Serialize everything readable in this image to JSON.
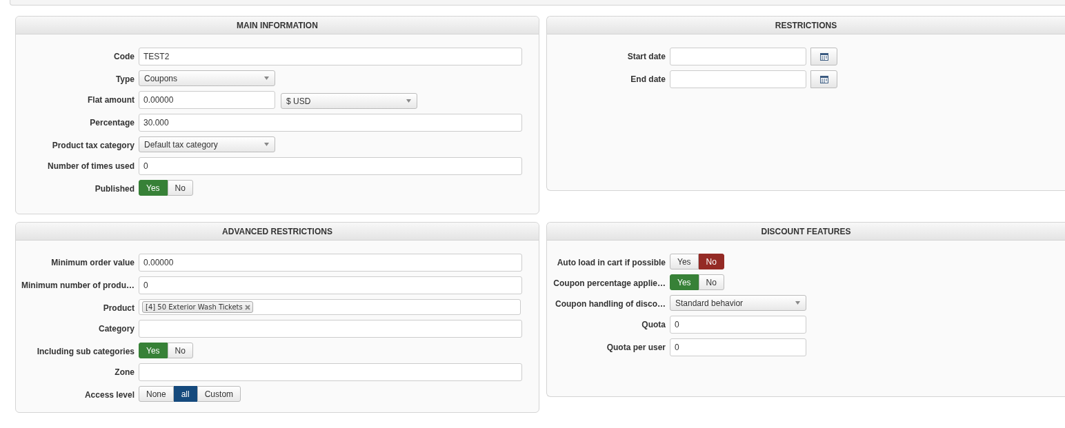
{
  "panels": [
    {
      "title": "MAIN INFORMATION",
      "fields": [
        {
          "kind": "text",
          "label": "Code",
          "value": "TEST2"
        },
        {
          "kind": "select",
          "label": "Type",
          "value": "Coupons"
        },
        {
          "kind": "amount",
          "label": "Flat amount",
          "value": "0.00000",
          "currency": "$ USD"
        },
        {
          "kind": "text",
          "label": "Percentage",
          "value": "30.000"
        },
        {
          "kind": "select",
          "label": "Product tax category",
          "value": "Default tax category"
        },
        {
          "kind": "text",
          "label": "Number of times used",
          "value": "0"
        },
        {
          "kind": "toggle",
          "label": "Published",
          "color": "#378137",
          "options": [
            {
              "label": "Yes",
              "selected": true
            },
            {
              "label": "No",
              "selected": false
            }
          ]
        }
      ]
    },
    {
      "title": "RESTRICTIONS",
      "fields": [
        {
          "kind": "date",
          "label": "Start date"
        },
        {
          "kind": "date",
          "label": "End date"
        }
      ]
    },
    {
      "title": "ADVANCED RESTRICTIONS",
      "fields": [
        {
          "kind": "text",
          "label": "Minimum order value",
          "value": "0.00000"
        },
        {
          "kind": "text",
          "label": "Minimum number of produ…",
          "value": "0"
        },
        {
          "kind": "tags",
          "label": "Product",
          "tags": [
            "[4] 50 Exterior Wash Tickets"
          ]
        },
        {
          "kind": "text",
          "label": "Category"
        },
        {
          "kind": "toggle",
          "label": "Including sub categories",
          "color": "#378137",
          "options": [
            {
              "label": "Yes",
              "selected": true
            },
            {
              "label": "No",
              "selected": false
            }
          ]
        },
        {
          "kind": "text",
          "label": "Zone"
        },
        {
          "kind": "toggle",
          "label": "Access level",
          "color": "#154a7d",
          "options": [
            {
              "label": "None",
              "selected": false
            },
            {
              "label": "all",
              "selected": true
            },
            {
              "label": "Custom",
              "selected": false
            }
          ]
        }
      ]
    },
    {
      "title": "DISCOUNT FEATURES",
      "fields": [
        {
          "kind": "toggle",
          "label": "Auto load in cart if possible",
          "color": "#942a25",
          "options": [
            {
              "label": "Yes",
              "selected": false
            },
            {
              "label": "No",
              "selected": true
            }
          ]
        },
        {
          "kind": "toggle",
          "label": "Coupon percentage applie…",
          "color": "#378137",
          "options": [
            {
              "label": "Yes",
              "selected": true
            },
            {
              "label": "No",
              "selected": false
            }
          ]
        },
        {
          "kind": "select",
          "label": "Coupon handling of disco…",
          "value": "Standard behavior",
          "short": true
        },
        {
          "kind": "text",
          "label": "Quota",
          "value": "0",
          "short": true
        },
        {
          "kind": "text",
          "label": "Quota per user",
          "value": "0",
          "short": true
        }
      ]
    }
  ]
}
